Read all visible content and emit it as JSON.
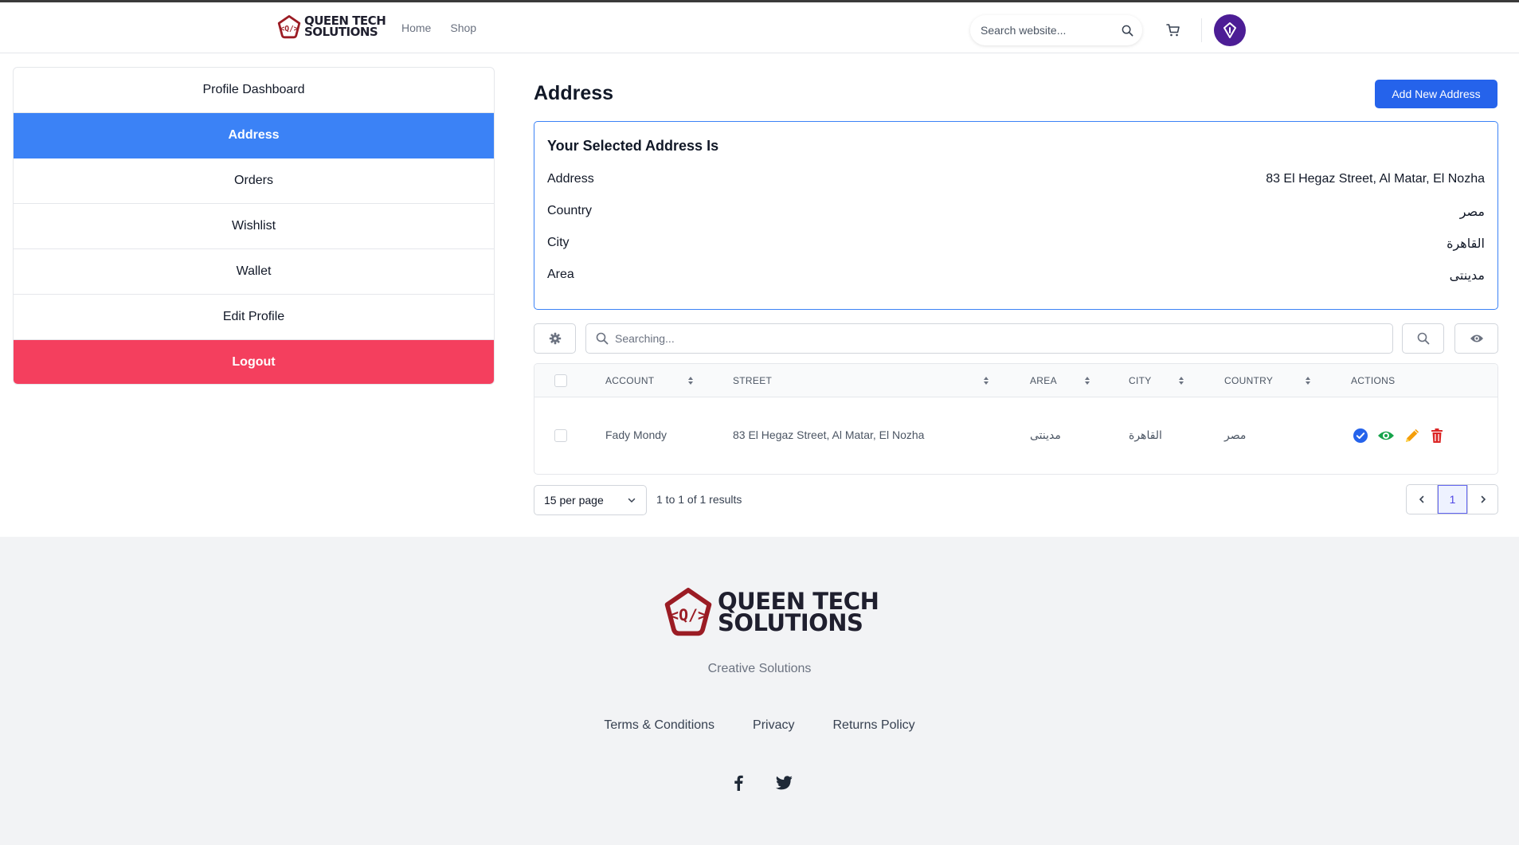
{
  "header": {
    "brand_line1": "QUEEN TECH",
    "brand_line2": "SOLUTIONS",
    "nav": [
      "Home",
      "Shop"
    ],
    "search_placeholder": "Search website..."
  },
  "sidebar": {
    "items": [
      {
        "label": "Profile Dashboard"
      },
      {
        "label": "Address"
      },
      {
        "label": "Orders"
      },
      {
        "label": "Wishlist"
      },
      {
        "label": "Wallet"
      },
      {
        "label": "Edit Profile"
      },
      {
        "label": "Logout"
      }
    ]
  },
  "main": {
    "title": "Address",
    "add_button": "Add New Address",
    "selected": {
      "heading": "Your Selected Address Is",
      "rows": [
        {
          "label": "Address",
          "value": "83 El Hegaz Street, Al Matar, El Nozha"
        },
        {
          "label": "Country",
          "value": "مصر"
        },
        {
          "label": "City",
          "value": "القاهرة"
        },
        {
          "label": "Area",
          "value": "مدينتى"
        }
      ]
    },
    "table": {
      "search_placeholder": "Searching...",
      "columns": [
        "ACCOUNT",
        "STREET",
        "AREA",
        "CITY",
        "COUNTRY",
        "ACTIONS"
      ],
      "rows": [
        {
          "account": "Fady Mondy",
          "street": "83 El Hegaz Street, Al Matar, El Nozha",
          "area": "مدينتى",
          "city": "القاهرة",
          "country": "مصر"
        }
      ]
    },
    "pagination": {
      "per_page": "15 per page",
      "results": "1 to 1 of 1 results",
      "current_page": "1"
    }
  },
  "footer": {
    "brand_line1": "QUEEN TECH",
    "brand_line2": "SOLUTIONS",
    "tagline": "Creative Solutions",
    "links": [
      "Terms & Conditions",
      "Privacy",
      "Returns Policy"
    ]
  },
  "colors": {
    "primary": "#3b82f6",
    "button": "#2563eb",
    "danger": "#f43f5e",
    "avatar": "#4c1d95",
    "logo_red": "#9b1c24"
  },
  "icons": [
    "search-icon",
    "cart-icon",
    "avatar-icon",
    "gear-icon",
    "eye-icon",
    "sort-icon",
    "check-circle-icon",
    "view-icon",
    "edit-pencil-icon",
    "trash-icon",
    "chevron-left-icon",
    "chevron-right-icon",
    "chevron-down-icon",
    "facebook-icon",
    "twitter-icon"
  ]
}
